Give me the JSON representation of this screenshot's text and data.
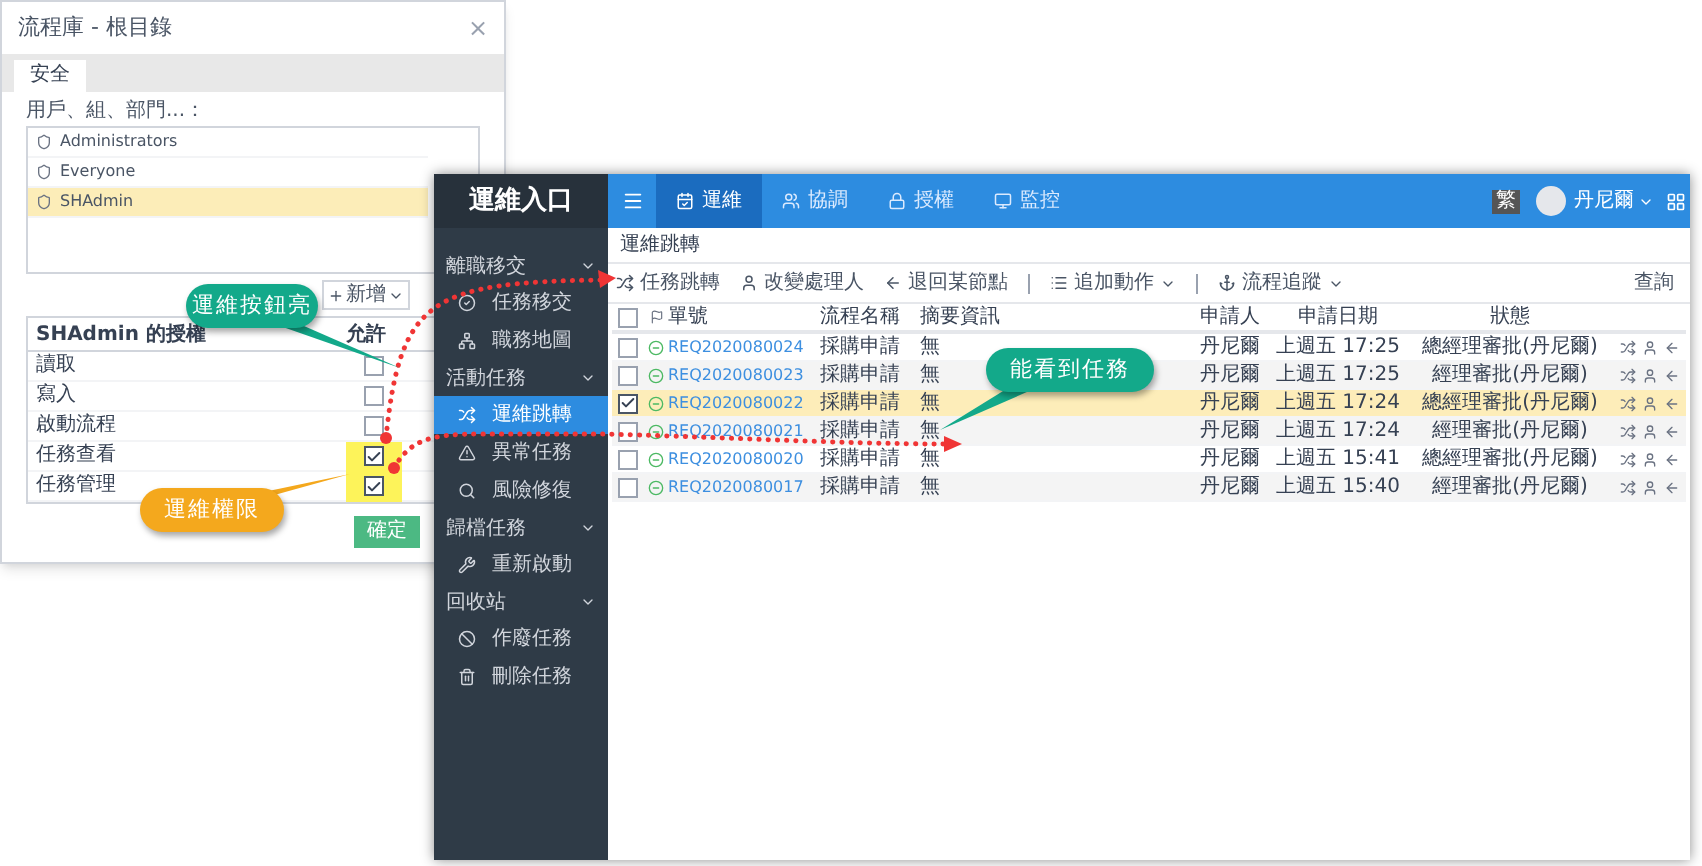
{
  "dialog": {
    "title": "流程庫 - 根目錄",
    "close": "×",
    "tabs": [
      {
        "label": "安全",
        "selected": true
      }
    ],
    "users_label": "用戶、組、部門...：",
    "users": [
      {
        "name": "Administrators",
        "selected": false
      },
      {
        "name": "Everyone",
        "selected": false
      },
      {
        "name": "SHAdmin",
        "selected": true
      }
    ],
    "add_button": "新增",
    "permissions_title": "SHAdmin 的授權",
    "allow_header": "允許",
    "permissions": [
      {
        "label": "讀取",
        "checked": false,
        "highlighted": false
      },
      {
        "label": "寫入",
        "checked": false,
        "highlighted": false
      },
      {
        "label": "啟動流程",
        "checked": false,
        "highlighted": false
      },
      {
        "label": "任務查看",
        "checked": true,
        "highlighted": true
      },
      {
        "label": "任務管理",
        "checked": true,
        "highlighted": true
      }
    ],
    "ok_button": "確定"
  },
  "app": {
    "title": "運維入口",
    "nav": [
      {
        "label": "運維",
        "selected": true
      },
      {
        "label": "協調",
        "selected": false
      },
      {
        "label": "授權",
        "selected": false
      },
      {
        "label": "監控",
        "selected": false
      }
    ],
    "language": "繁",
    "user": "丹尼爾",
    "sidebar": [
      {
        "label": "離職移交",
        "children": [
          {
            "label": "任務移交",
            "selected": false
          },
          {
            "label": "職務地圖",
            "selected": false
          }
        ]
      },
      {
        "label": "活動任務",
        "children": [
          {
            "label": "運維跳轉",
            "selected": true
          },
          {
            "label": "異常任務",
            "selected": false
          },
          {
            "label": "風險修復",
            "selected": false
          }
        ]
      },
      {
        "label": "歸檔任務",
        "children": [
          {
            "label": "重新啟動",
            "selected": false
          }
        ]
      },
      {
        "label": "回收站",
        "children": [
          {
            "label": "作廢任務",
            "selected": false
          },
          {
            "label": "刪除任務",
            "selected": false
          }
        ]
      }
    ],
    "breadcrumb": "運維跳轉",
    "toolbar": [
      {
        "label": "任務跳轉",
        "kind": "button"
      },
      {
        "label": "改變處理人",
        "kind": "button"
      },
      {
        "label": "退回某節點",
        "kind": "button"
      },
      {
        "label": "追加動作",
        "kind": "dropdown"
      },
      {
        "label": "流程追蹤",
        "kind": "dropdown"
      }
    ],
    "search": "查詢",
    "table": {
      "select_all_checked": false,
      "columns": [
        "單號",
        "流程名稱",
        "摘要資訊",
        "申請人",
        "申請日期",
        "狀態"
      ],
      "rows": [
        {
          "checked": false,
          "id": "REQ2020080024",
          "process": "採購申請",
          "summary": "無",
          "applicant": "丹尼爾",
          "date": "上週五 17:25",
          "status": "總經理審批(丹尼爾)"
        },
        {
          "checked": false,
          "id": "REQ2020080023",
          "process": "採購申請",
          "summary": "無",
          "applicant": "丹尼爾",
          "date": "上週五 17:25",
          "status": "經理審批(丹尼爾)"
        },
        {
          "checked": true,
          "id": "REQ2020080022",
          "process": "採購申請",
          "summary": "無",
          "applicant": "丹尼爾",
          "date": "上週五 17:24",
          "status": "總經理審批(丹尼爾)"
        },
        {
          "checked": false,
          "id": "REQ2020080021",
          "process": "採購申請",
          "summary": "無",
          "applicant": "丹尼爾",
          "date": "上週五 17:24",
          "status": "經理審批(丹尼爾)"
        },
        {
          "checked": false,
          "id": "REQ2020080020",
          "process": "採購申請",
          "summary": "無",
          "applicant": "丹尼爾",
          "date": "上週五 15:41",
          "status": "總經理審批(丹尼爾)"
        },
        {
          "checked": false,
          "id": "REQ2020080017",
          "process": "採購申請",
          "summary": "無",
          "applicant": "丹尼爾",
          "date": "上週五 15:40",
          "status": "經理審批(丹尼爾)"
        }
      ]
    }
  },
  "callouts": [
    {
      "text": "運維按鈕亮",
      "color": "#13a98a"
    },
    {
      "text": "運維權限",
      "color": "#f4a81d"
    },
    {
      "text": "能看到任務",
      "color": "#13a98a"
    }
  ]
}
